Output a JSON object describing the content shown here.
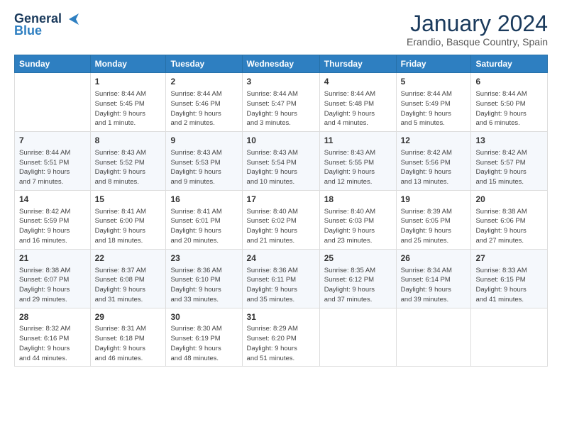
{
  "header": {
    "logo_line1": "General",
    "logo_line2": "Blue",
    "month_title": "January 2024",
    "location": "Erandio, Basque Country, Spain"
  },
  "calendar": {
    "headers": [
      "Sunday",
      "Monday",
      "Tuesday",
      "Wednesday",
      "Thursday",
      "Friday",
      "Saturday"
    ],
    "weeks": [
      [
        {
          "day": "",
          "detail": ""
        },
        {
          "day": "1",
          "detail": "Sunrise: 8:44 AM\nSunset: 5:45 PM\nDaylight: 9 hours\nand 1 minute."
        },
        {
          "day": "2",
          "detail": "Sunrise: 8:44 AM\nSunset: 5:46 PM\nDaylight: 9 hours\nand 2 minutes."
        },
        {
          "day": "3",
          "detail": "Sunrise: 8:44 AM\nSunset: 5:47 PM\nDaylight: 9 hours\nand 3 minutes."
        },
        {
          "day": "4",
          "detail": "Sunrise: 8:44 AM\nSunset: 5:48 PM\nDaylight: 9 hours\nand 4 minutes."
        },
        {
          "day": "5",
          "detail": "Sunrise: 8:44 AM\nSunset: 5:49 PM\nDaylight: 9 hours\nand 5 minutes."
        },
        {
          "day": "6",
          "detail": "Sunrise: 8:44 AM\nSunset: 5:50 PM\nDaylight: 9 hours\nand 6 minutes."
        }
      ],
      [
        {
          "day": "7",
          "detail": "Sunrise: 8:44 AM\nSunset: 5:51 PM\nDaylight: 9 hours\nand 7 minutes."
        },
        {
          "day": "8",
          "detail": "Sunrise: 8:43 AM\nSunset: 5:52 PM\nDaylight: 9 hours\nand 8 minutes."
        },
        {
          "day": "9",
          "detail": "Sunrise: 8:43 AM\nSunset: 5:53 PM\nDaylight: 9 hours\nand 9 minutes."
        },
        {
          "day": "10",
          "detail": "Sunrise: 8:43 AM\nSunset: 5:54 PM\nDaylight: 9 hours\nand 10 minutes."
        },
        {
          "day": "11",
          "detail": "Sunrise: 8:43 AM\nSunset: 5:55 PM\nDaylight: 9 hours\nand 12 minutes."
        },
        {
          "day": "12",
          "detail": "Sunrise: 8:42 AM\nSunset: 5:56 PM\nDaylight: 9 hours\nand 13 minutes."
        },
        {
          "day": "13",
          "detail": "Sunrise: 8:42 AM\nSunset: 5:57 PM\nDaylight: 9 hours\nand 15 minutes."
        }
      ],
      [
        {
          "day": "14",
          "detail": "Sunrise: 8:42 AM\nSunset: 5:59 PM\nDaylight: 9 hours\nand 16 minutes."
        },
        {
          "day": "15",
          "detail": "Sunrise: 8:41 AM\nSunset: 6:00 PM\nDaylight: 9 hours\nand 18 minutes."
        },
        {
          "day": "16",
          "detail": "Sunrise: 8:41 AM\nSunset: 6:01 PM\nDaylight: 9 hours\nand 20 minutes."
        },
        {
          "day": "17",
          "detail": "Sunrise: 8:40 AM\nSunset: 6:02 PM\nDaylight: 9 hours\nand 21 minutes."
        },
        {
          "day": "18",
          "detail": "Sunrise: 8:40 AM\nSunset: 6:03 PM\nDaylight: 9 hours\nand 23 minutes."
        },
        {
          "day": "19",
          "detail": "Sunrise: 8:39 AM\nSunset: 6:05 PM\nDaylight: 9 hours\nand 25 minutes."
        },
        {
          "day": "20",
          "detail": "Sunrise: 8:38 AM\nSunset: 6:06 PM\nDaylight: 9 hours\nand 27 minutes."
        }
      ],
      [
        {
          "day": "21",
          "detail": "Sunrise: 8:38 AM\nSunset: 6:07 PM\nDaylight: 9 hours\nand 29 minutes."
        },
        {
          "day": "22",
          "detail": "Sunrise: 8:37 AM\nSunset: 6:08 PM\nDaylight: 9 hours\nand 31 minutes."
        },
        {
          "day": "23",
          "detail": "Sunrise: 8:36 AM\nSunset: 6:10 PM\nDaylight: 9 hours\nand 33 minutes."
        },
        {
          "day": "24",
          "detail": "Sunrise: 8:36 AM\nSunset: 6:11 PM\nDaylight: 9 hours\nand 35 minutes."
        },
        {
          "day": "25",
          "detail": "Sunrise: 8:35 AM\nSunset: 6:12 PM\nDaylight: 9 hours\nand 37 minutes."
        },
        {
          "day": "26",
          "detail": "Sunrise: 8:34 AM\nSunset: 6:14 PM\nDaylight: 9 hours\nand 39 minutes."
        },
        {
          "day": "27",
          "detail": "Sunrise: 8:33 AM\nSunset: 6:15 PM\nDaylight: 9 hours\nand 41 minutes."
        }
      ],
      [
        {
          "day": "28",
          "detail": "Sunrise: 8:32 AM\nSunset: 6:16 PM\nDaylight: 9 hours\nand 44 minutes."
        },
        {
          "day": "29",
          "detail": "Sunrise: 8:31 AM\nSunset: 6:18 PM\nDaylight: 9 hours\nand 46 minutes."
        },
        {
          "day": "30",
          "detail": "Sunrise: 8:30 AM\nSunset: 6:19 PM\nDaylight: 9 hours\nand 48 minutes."
        },
        {
          "day": "31",
          "detail": "Sunrise: 8:29 AM\nSunset: 6:20 PM\nDaylight: 9 hours\nand 51 minutes."
        },
        {
          "day": "",
          "detail": ""
        },
        {
          "day": "",
          "detail": ""
        },
        {
          "day": "",
          "detail": ""
        }
      ]
    ]
  }
}
